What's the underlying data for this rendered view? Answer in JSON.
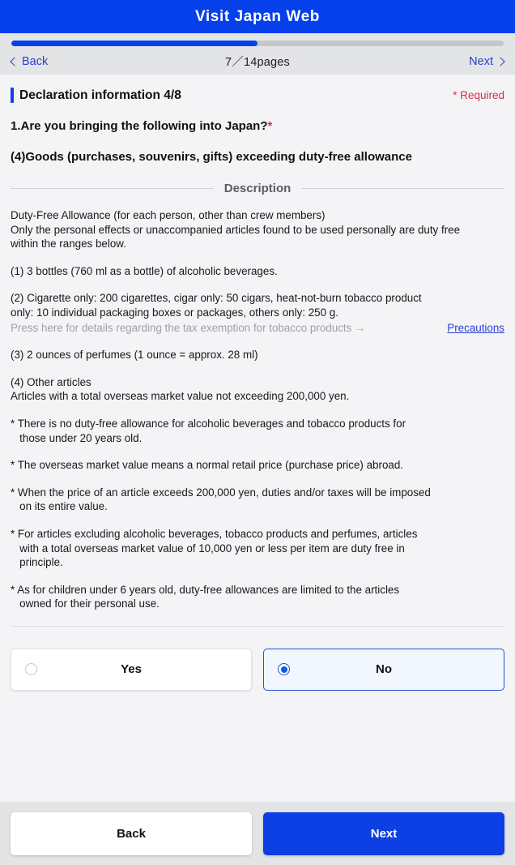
{
  "app": {
    "title": "Visit Japan Web",
    "header_color": "#0540ea"
  },
  "pager": {
    "back_label": "Back",
    "next_label": "Next",
    "count_text": "7／14pages",
    "progress_percent": 50,
    "progress_color": "#0540ea"
  },
  "section": {
    "title": "Declaration information 4/8",
    "required_note": "* Required",
    "required_color": "#d22f45",
    "accent_color": "#1540e8"
  },
  "question": {
    "text": "1.Are you bringing the following into Japan?",
    "required_mark": "*",
    "subtext": "(4)Goods (purchases, souvenirs, gifts) exceeding duty-free allowance"
  },
  "description": {
    "heading": "Description",
    "blocks": [
      {
        "lines": [
          "Duty-Free Allowance (for each person, other than crew members)",
          "Only the personal effects or unaccompanied articles found to be used personally are duty free",
          "within the ranges below."
        ]
      },
      {
        "lines": [
          "(1) 3 bottles (760 ml as a bottle) of alcoholic beverages."
        ]
      },
      {
        "lines": [
          "(2) Cigarette only: 200 cigarettes, cigar only: 50 cigars, heat-not-burn tobacco product",
          "only: 10 individual packaging boxes or packages, others only: 250 g."
        ],
        "note": "Press here for details regarding the tax exemption for tobacco products →",
        "link": "Precautions"
      },
      {
        "lines": [
          "(3) 2 ounces of perfumes (1 ounce = approx. 28 ml)"
        ]
      },
      {
        "lines": [
          "(4) Other articles",
          "Articles with a total overseas market value not exceeding 200,000 yen."
        ]
      },
      {
        "lines": [
          "* There is no duty-free allowance for alcoholic beverages and tobacco products for",
          "   those under 20 years old."
        ]
      },
      {
        "lines": [
          "* The overseas market value means a normal retail price (purchase price) abroad."
        ]
      },
      {
        "lines": [
          "* When the price of an article exceeds 200,000 yen, duties and/or taxes will be imposed",
          "   on its entire value."
        ]
      },
      {
        "lines": [
          "* For articles excluding alcoholic beverages, tobacco products and perfumes, articles",
          "   with a total overseas market value of 10,000 yen or less per item are duty free in",
          "   principle."
        ]
      },
      {
        "lines": [
          "* As for children under 6 years old, duty-free allowances are limited to the articles",
          "   owned for their personal use."
        ]
      }
    ]
  },
  "answer": {
    "yes_label": "Yes",
    "no_label": "No",
    "selected": "No",
    "selected_border_color": "#2552cf",
    "selected_fill_color": "#f2f6ff",
    "radio_dot_color": "#0f5ae8"
  },
  "footer": {
    "back_label": "Back",
    "next_label": "Next",
    "next_color": "#0c3fe4"
  }
}
